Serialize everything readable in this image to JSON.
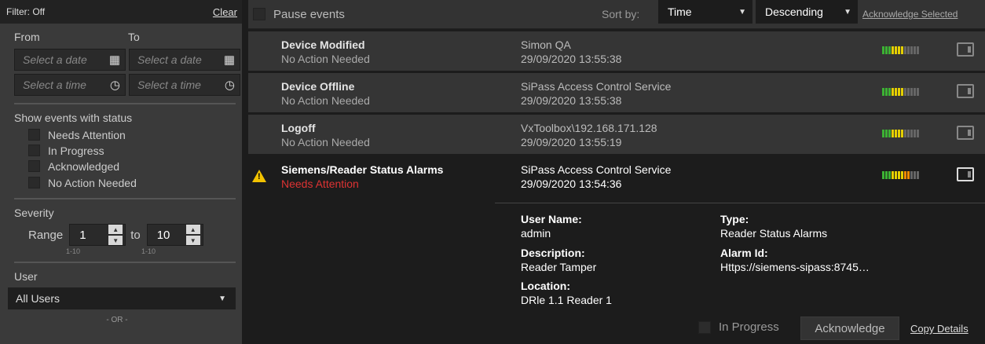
{
  "filter": {
    "title": "Filter: Off",
    "clear": "Clear",
    "from": "From",
    "to": "To",
    "date_placeholder": "Select a date",
    "time_placeholder": "Select a time",
    "status_title": "Show events with status",
    "statuses": [
      "Needs Attention",
      "In Progress",
      "Acknowledged",
      "No Action Needed"
    ],
    "severity_title": "Severity",
    "range_label": "Range",
    "range_from": "1",
    "range_to_label": "to",
    "range_to": "10",
    "range_hint": "1-10",
    "user_title": "User",
    "user_value": "All Users",
    "or": "- OR -"
  },
  "toolbar": {
    "pause": "Pause events",
    "sort_by": "Sort by:",
    "sort_field": "Time",
    "sort_order": "Descending",
    "ack_selected": "Acknowledge Selected"
  },
  "events": [
    {
      "title": "Device Modified",
      "status": "No Action Needed",
      "source": "Simon QA",
      "time": "29/09/2020 13:55:38",
      "severity": 7
    },
    {
      "title": "Device Offline",
      "status": "No Action Needed",
      "source": "SiPass Access Control Service",
      "time": "29/09/2020 13:55:38",
      "severity": 7
    },
    {
      "title": "Logoff",
      "status": "No Action Needed",
      "source": "VxToolbox\\192.168.171.128",
      "time": "29/09/2020 13:55:19",
      "severity": 7
    },
    {
      "title": "Siemens/Reader Status Alarms",
      "status": "Needs Attention",
      "source": "SiPass Access Control Service",
      "time": "29/09/2020 13:54:36",
      "severity": 9
    }
  ],
  "details": {
    "user_name_label": "User Name:",
    "user_name": "admin",
    "type_label": "Type:",
    "type": "Reader Status Alarms",
    "description_label": "Description:",
    "description": "Reader Tamper",
    "alarm_id_label": "Alarm Id:",
    "alarm_id": "Https://siemens-sipass:8745…",
    "location_label": "Location:",
    "location": "DRle 1.1  Reader 1",
    "in_progress": "In Progress",
    "acknowledge": "Acknowledge",
    "copy": "Copy Details"
  },
  "colors": {
    "sev_green": "#3cb233",
    "sev_yellow": "#e5d000",
    "sev_orange": "#f08a00",
    "sev_grey": "#666666",
    "warning": "#f2c200",
    "attention": "#dd3333"
  }
}
